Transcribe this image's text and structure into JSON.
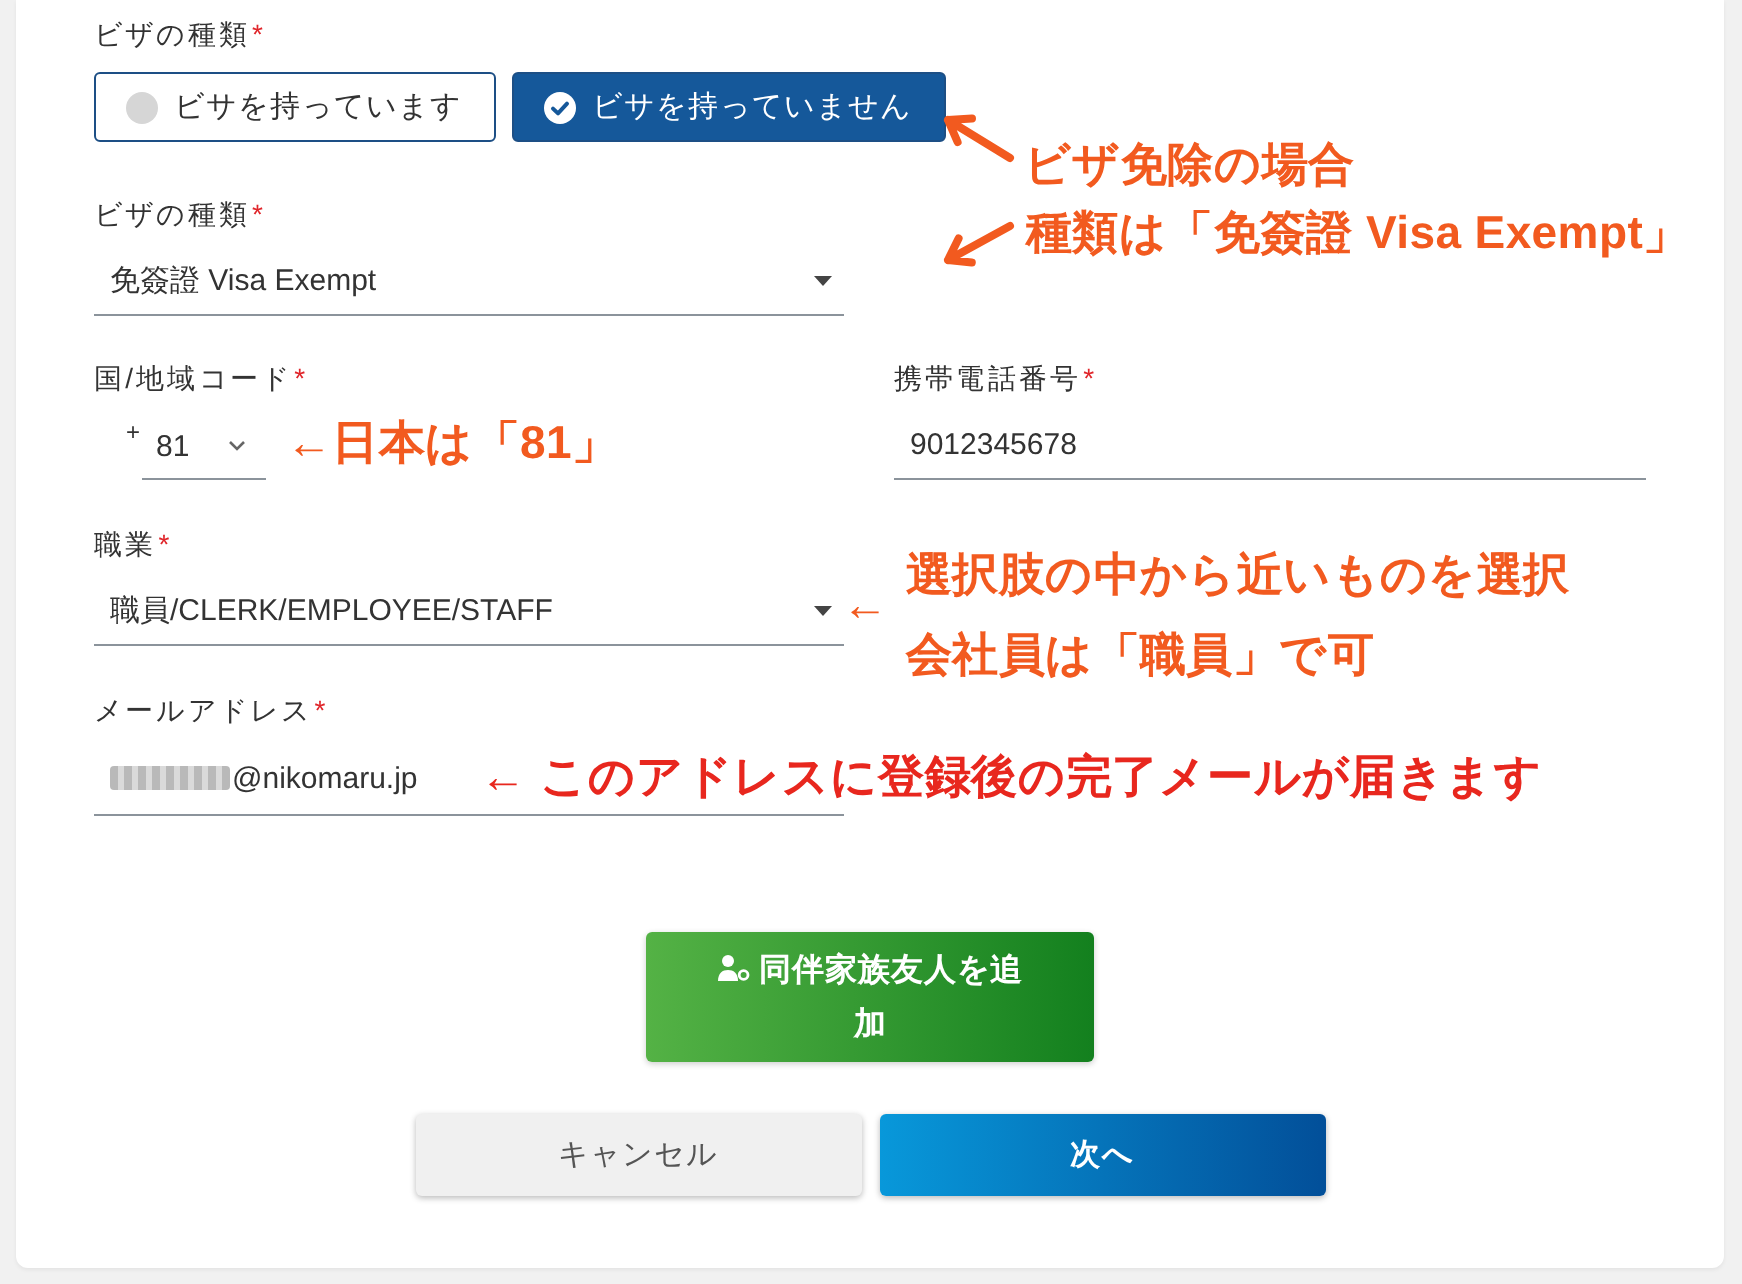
{
  "visa_status": {
    "label": "ビザの種類",
    "required_mark": "*",
    "options": [
      {
        "label": "ビサを持っています",
        "selected": false
      },
      {
        "label": "ビサを持っていません",
        "selected": true
      }
    ]
  },
  "visa_type": {
    "label": "ビザの種類",
    "required_mark": "*",
    "value": "免簽證 Visa Exempt"
  },
  "country_code": {
    "label": "国/地域コード",
    "required_mark": "*",
    "prefix": "+",
    "value": "81"
  },
  "mobile_number": {
    "label": "携帯電話番号",
    "required_mark": "*",
    "value": "9012345678"
  },
  "occupation": {
    "label": "職業",
    "required_mark": "*",
    "value": "職員/CLERK/EMPLOYEE/STAFF"
  },
  "email": {
    "label": "メールアドレス",
    "required_mark": "*",
    "blurred_prefix": true,
    "value": "@nikomaru.jp"
  },
  "buttons": [
    {
      "kind": "add",
      "label": "同伴家族友人を追加"
    },
    {
      "kind": "cancel",
      "label": "キャンセル"
    },
    {
      "kind": "next",
      "label": "次へ"
    }
  ],
  "annotations": [
    {
      "kind": "arrow_up_left",
      "lines": [
        "ビザ免除の場合"
      ],
      "color": "#f25a1f"
    },
    {
      "kind": "arrow_down_left",
      "lines": [
        "種類は「免簽證 Visa Exempt」"
      ],
      "color": "#f25a1f"
    },
    {
      "kind": "text",
      "lines": [
        "←日本は「81」"
      ],
      "color": "#f25a1f"
    },
    {
      "kind": "text",
      "lines": [
        "←"
      ],
      "color": "#f25a1f"
    },
    {
      "kind": "text",
      "lines": [
        "選択肢の中から近いものを選択",
        "会社員は「職員」で可"
      ],
      "color": "#f25a1f"
    },
    {
      "kind": "text",
      "lines": [
        "← このアドレスに登録後の完了メールが届きます"
      ],
      "color": "#e8271e"
    }
  ]
}
